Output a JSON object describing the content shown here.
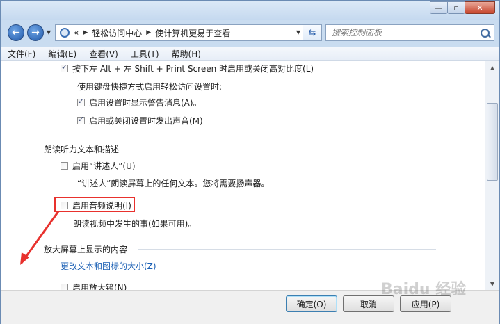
{
  "titlebar": {
    "minimize": "—",
    "restore": "▫",
    "close": "✕"
  },
  "address": {
    "overflow": "«",
    "crumbs": [
      "轻松访问中心",
      "使计算机更易于查看"
    ],
    "search_placeholder": "搜索控制面板"
  },
  "menu": [
    "文件(F)",
    "编辑(E)",
    "查看(V)",
    "工具(T)",
    "帮助(H)"
  ],
  "content": {
    "high_contrast_toggle": "按下左 Alt + 左 Shift + Print Screen 时启用或关闭高对比度(L)",
    "shortcut_intro": "使用键盘快捷方式启用轻松访问设置时:",
    "show_warning": "启用设置时显示警告消息(A)。",
    "play_sound": "启用或关闭设置时发出声音(M)",
    "narration_section": "朗读听力文本和描述",
    "narrator_toggle": "启用“讲述人”(U)",
    "narrator_desc": "“讲述人”朗读屏幕上的任何文本。您将需要扬声器。",
    "audio_desc_toggle": "启用音频说明(I)",
    "audio_desc_desc": "朗读视频中发生的事(如果可用)。",
    "magnify_section": "放大屏幕上显示的内容",
    "text_size_link": "更改文本和图标的大小(Z)",
    "magnifier_toggle": "启用放大镜(N)"
  },
  "buttons": {
    "ok": "确定(O)",
    "cancel": "取消",
    "apply": "应用(P)"
  },
  "watermark": "Baidu 经验",
  "colors": {
    "highlight": "#e8312d",
    "link": "#1a5fb4"
  }
}
